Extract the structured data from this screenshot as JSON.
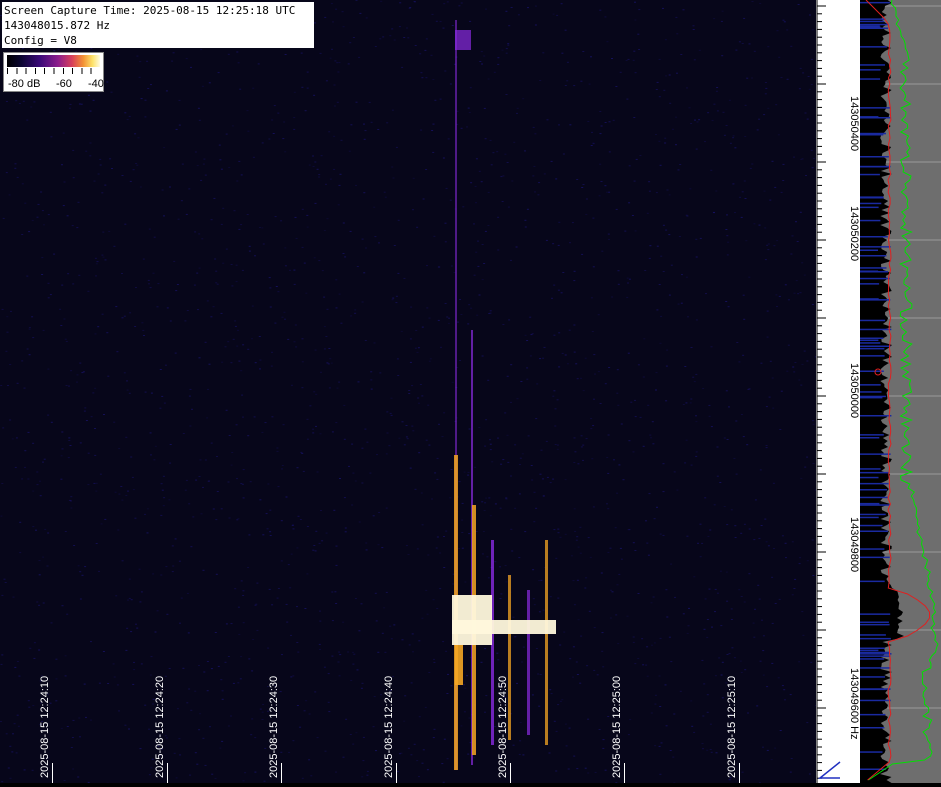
{
  "info": {
    "capture_time": "Screen Capture Time: 2025-08-15 12:25:18 UTC",
    "frequency": "143048015.872 Hz",
    "config": "Config = V8"
  },
  "legend": {
    "labels": [
      "-80 dB",
      "-60",
      "-40"
    ]
  },
  "time_axis": {
    "labels": [
      "2025-08-15 12:24:10",
      "2025-08-15 12:24:20",
      "2025-08-15 12:24:30",
      "2025-08-15 12:24:40",
      "2025-08-15 12:24:50",
      "2025-08-15 12:25:00",
      "2025-08-15 12:25:10"
    ]
  },
  "freq_axis": {
    "labels": [
      "143050400",
      "143050200",
      "143050000",
      "143049800",
      "143049600 Hz"
    ]
  },
  "colors": {
    "background": "#07061a",
    "noise": "#1a1470",
    "signal_hot": "#fff8dc",
    "signal_warm": "#f5a623",
    "signal_cool": "#8a2be2",
    "spectrum_bg": "#6e6e6e",
    "spectrum_peak": "#00e000",
    "spectrum_avg": "#e02020",
    "spectrum_fill": "#000000"
  }
}
